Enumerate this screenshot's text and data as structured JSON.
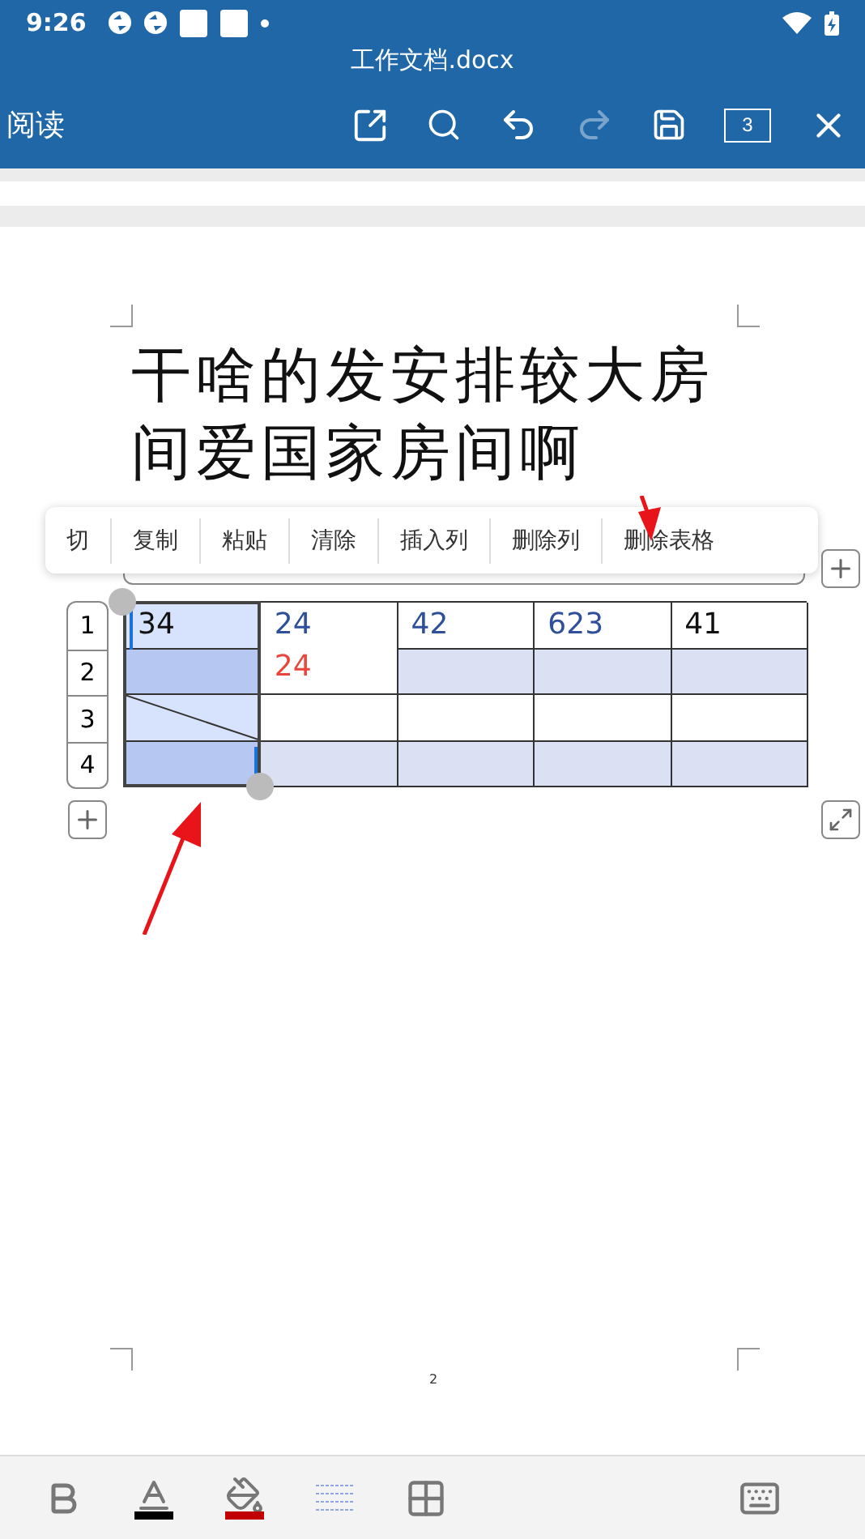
{
  "status_bar": {
    "time": "9:26"
  },
  "title_bar": {
    "title": "工作文档.docx"
  },
  "toolbar": {
    "mode": "阅读",
    "page_count": "3",
    "redo_disabled": true
  },
  "document": {
    "heading": "干啥的发安排较大房间爱国家房间啊",
    "page_number": "2"
  },
  "context_menu": {
    "items": [
      "切",
      "复制",
      "粘贴",
      "清除",
      "插入列",
      "删除列",
      "删除表格"
    ]
  },
  "table": {
    "row_headers": [
      "1",
      "2",
      "3",
      "4"
    ],
    "rows": [
      {
        "shaded": false,
        "cells": [
          {
            "text": "34",
            "selected": true
          },
          {
            "lines": [
              {
                "text": "24",
                "color": "#2f4f9a"
              },
              {
                "text": "24",
                "color": "#e8453c"
              }
            ],
            "merged": true,
            "selected": false
          },
          {
            "text": "42",
            "color": "#2f4f9a",
            "selected": false
          },
          {
            "text": "623",
            "color": "#2f4f9a",
            "selected": false
          },
          {
            "text": "41",
            "color": "#111111",
            "selected": false
          }
        ]
      },
      {
        "shaded": true,
        "cells": [
          {
            "selected": true
          },
          {
            "selected": false
          },
          {
            "selected": false
          },
          {
            "selected": false
          }
        ]
      },
      {
        "shaded": false,
        "cells": [
          {
            "selected": true,
            "diagonal": true
          },
          {
            "selected": false
          },
          {
            "selected": false
          },
          {
            "selected": false
          },
          {
            "selected": false
          }
        ]
      },
      {
        "shaded": true,
        "cells": [
          {
            "selected": true
          },
          {
            "selected": false
          },
          {
            "selected": false
          },
          {
            "selected": false
          },
          {
            "selected": false
          }
        ]
      }
    ]
  },
  "bottom_toolbar": {
    "tools": [
      {
        "kind": "bold"
      },
      {
        "kind": "font-color",
        "color": "#000000"
      },
      {
        "kind": "fill-color",
        "color": "#c00000"
      },
      {
        "kind": "gridlines"
      },
      {
        "kind": "table"
      },
      {
        "kind": "keyboard"
      }
    ]
  }
}
